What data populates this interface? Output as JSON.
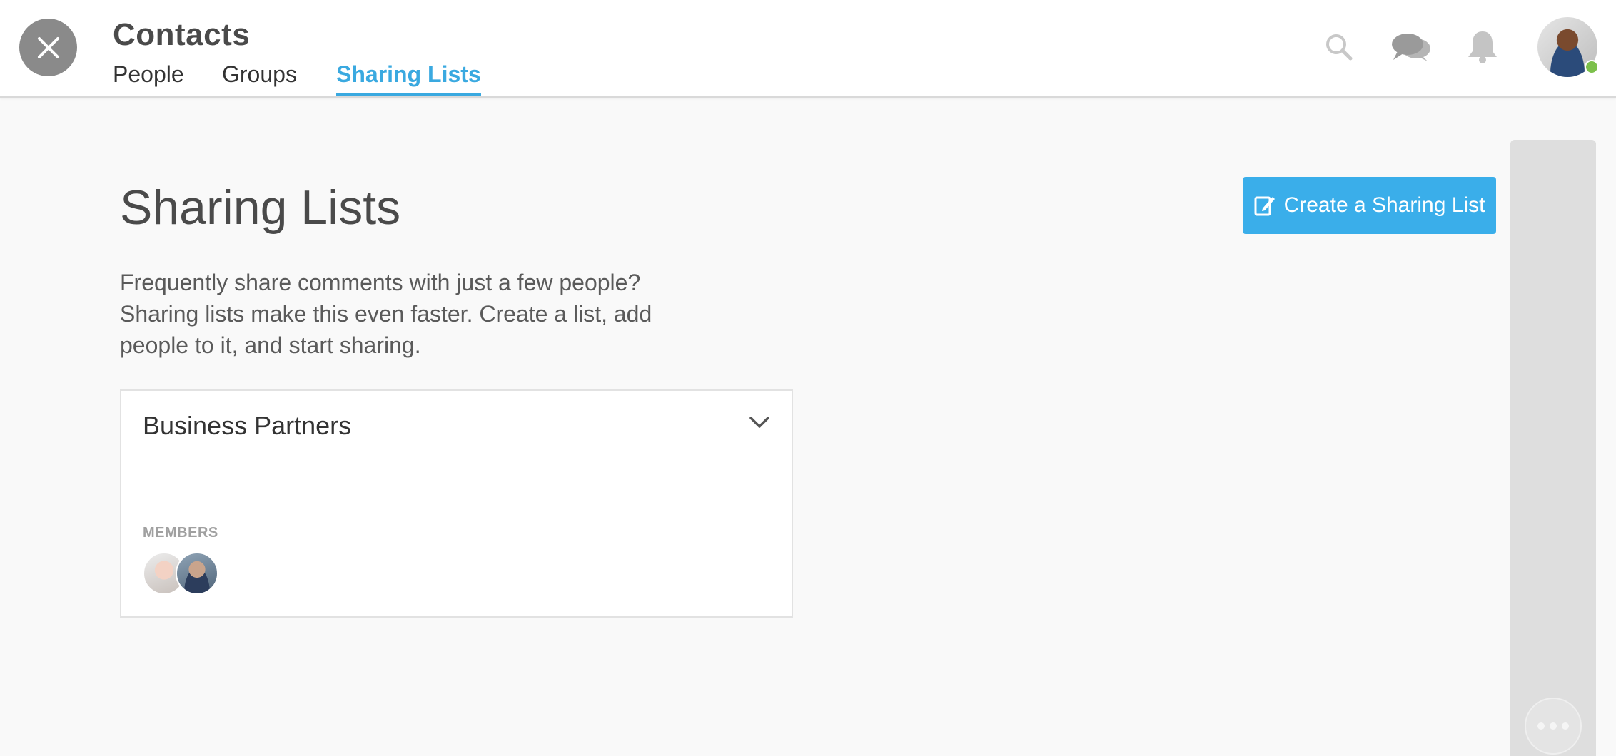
{
  "header": {
    "title": "Contacts",
    "tabs": [
      {
        "label": "People",
        "active": false
      },
      {
        "label": "Groups",
        "active": false
      },
      {
        "label": "Sharing Lists",
        "active": true
      }
    ],
    "icons": [
      "close-icon",
      "search-icon",
      "chat-icon",
      "bell-icon"
    ],
    "user_status": "online"
  },
  "main": {
    "heading": "Sharing Lists",
    "description": "Frequently share comments with just a few people? Sharing lists make this even faster. Create a list, add people to it, and start sharing.",
    "create_button_label": "Create a Sharing List",
    "lists": [
      {
        "name": "Business Partners",
        "members_label": "MEMBERS",
        "member_count": 2
      }
    ]
  },
  "colors": {
    "accent": "#3aa9e0",
    "button": "#3aaeea",
    "status_online": "#7cc04b",
    "background": "#f9f9f9"
  }
}
